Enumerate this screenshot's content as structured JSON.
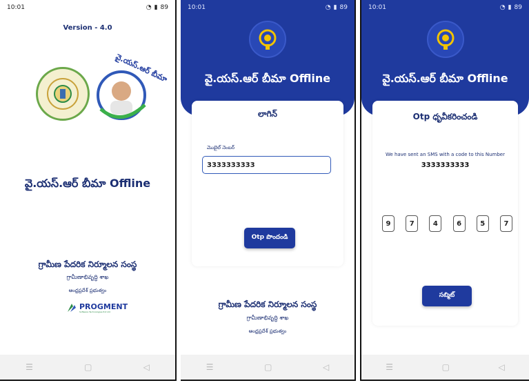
{
  "status": {
    "time": "10:01",
    "battery": "89"
  },
  "screen1": {
    "version": "Version - 4.0",
    "app_title": "వై.యస్.ఆర్ బీమా Offline",
    "org_name": "గ్రామీణ పేదరిక నిర్మూలన సంస్థ",
    "dept": "గ్రామీణాభివృద్ధి శాఖ",
    "govt": "ఆంధ్రప్రదేశ్ ప్రభుత్వం",
    "logo_text": "PROGMENT",
    "logo_sub": "Software Technologies Pvt Ltd",
    "scheme_logo_text": "వై.యస్.ఆర్ బీమా"
  },
  "screen2": {
    "header_title": "వై.యస్.ఆర్ బీమా Offline",
    "card_title": "లాగిన్",
    "mobile_label": "మొబైల్ నెంబర్",
    "mobile_value": "3333333333",
    "otp_button": "Otp పొందండి",
    "org_name": "గ్రామీణ పేదరిక నిర్మూలన సంస్థ",
    "dept": "గ్రామీణాభివృద్ధి శాఖ",
    "govt": "ఆంధ్రప్రదేశ్ ప్రభుత్వం"
  },
  "screen3": {
    "header_title": "వై.యస్.ఆర్ బీమా Offline",
    "card_title": "Otp ధృవీకరించండి",
    "sms_text": "We have sent an SMS with a code to this Number",
    "number": "3333333333",
    "otp_digits": [
      "9",
      "7",
      "4",
      "6",
      "5",
      "7"
    ],
    "submit_button": "సబ్మిట్"
  },
  "colors": {
    "primary": "#1f3a9e",
    "text": "#1c2f73",
    "accent": "#f2c300"
  },
  "icons": [
    "wifi-icon",
    "signal-icon",
    "battery-icon",
    "menu-nav-icon",
    "home-nav-icon",
    "back-nav-icon"
  ]
}
